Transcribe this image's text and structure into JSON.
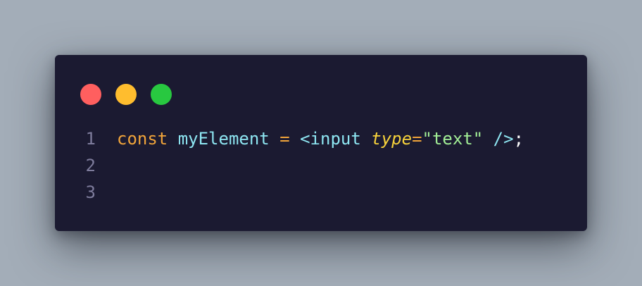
{
  "window": {
    "traffic_lights": [
      {
        "name": "close",
        "color": "#ff5f5f"
      },
      {
        "name": "minimize",
        "color": "#ffbd2e"
      },
      {
        "name": "maximize",
        "color": "#28c840"
      }
    ]
  },
  "code": {
    "line_numbers": [
      "1",
      "2",
      "3"
    ],
    "lines": [
      {
        "tokens": [
          {
            "type": "keyword",
            "text": "const"
          },
          {
            "type": "space",
            "text": " "
          },
          {
            "type": "ident",
            "text": "myElement"
          },
          {
            "type": "space",
            "text": " "
          },
          {
            "type": "op",
            "text": "="
          },
          {
            "type": "space",
            "text": " "
          },
          {
            "type": "tag",
            "text": "<input"
          },
          {
            "type": "space",
            "text": " "
          },
          {
            "type": "attr",
            "text": "type"
          },
          {
            "type": "eq",
            "text": "="
          },
          {
            "type": "str",
            "text": "\"text\""
          },
          {
            "type": "space",
            "text": " "
          },
          {
            "type": "close",
            "text": "/>"
          },
          {
            "type": "punct",
            "text": ";"
          }
        ]
      },
      {
        "tokens": []
      },
      {
        "tokens": []
      }
    ]
  },
  "colors": {
    "background": "#a3adb8",
    "window": "#1b1a31",
    "line_number": "#7e7c9c",
    "keyword": "#f1a43a",
    "identifier": "#8ee6f2",
    "attribute": "#f7d23b",
    "string": "#a2ee96"
  }
}
